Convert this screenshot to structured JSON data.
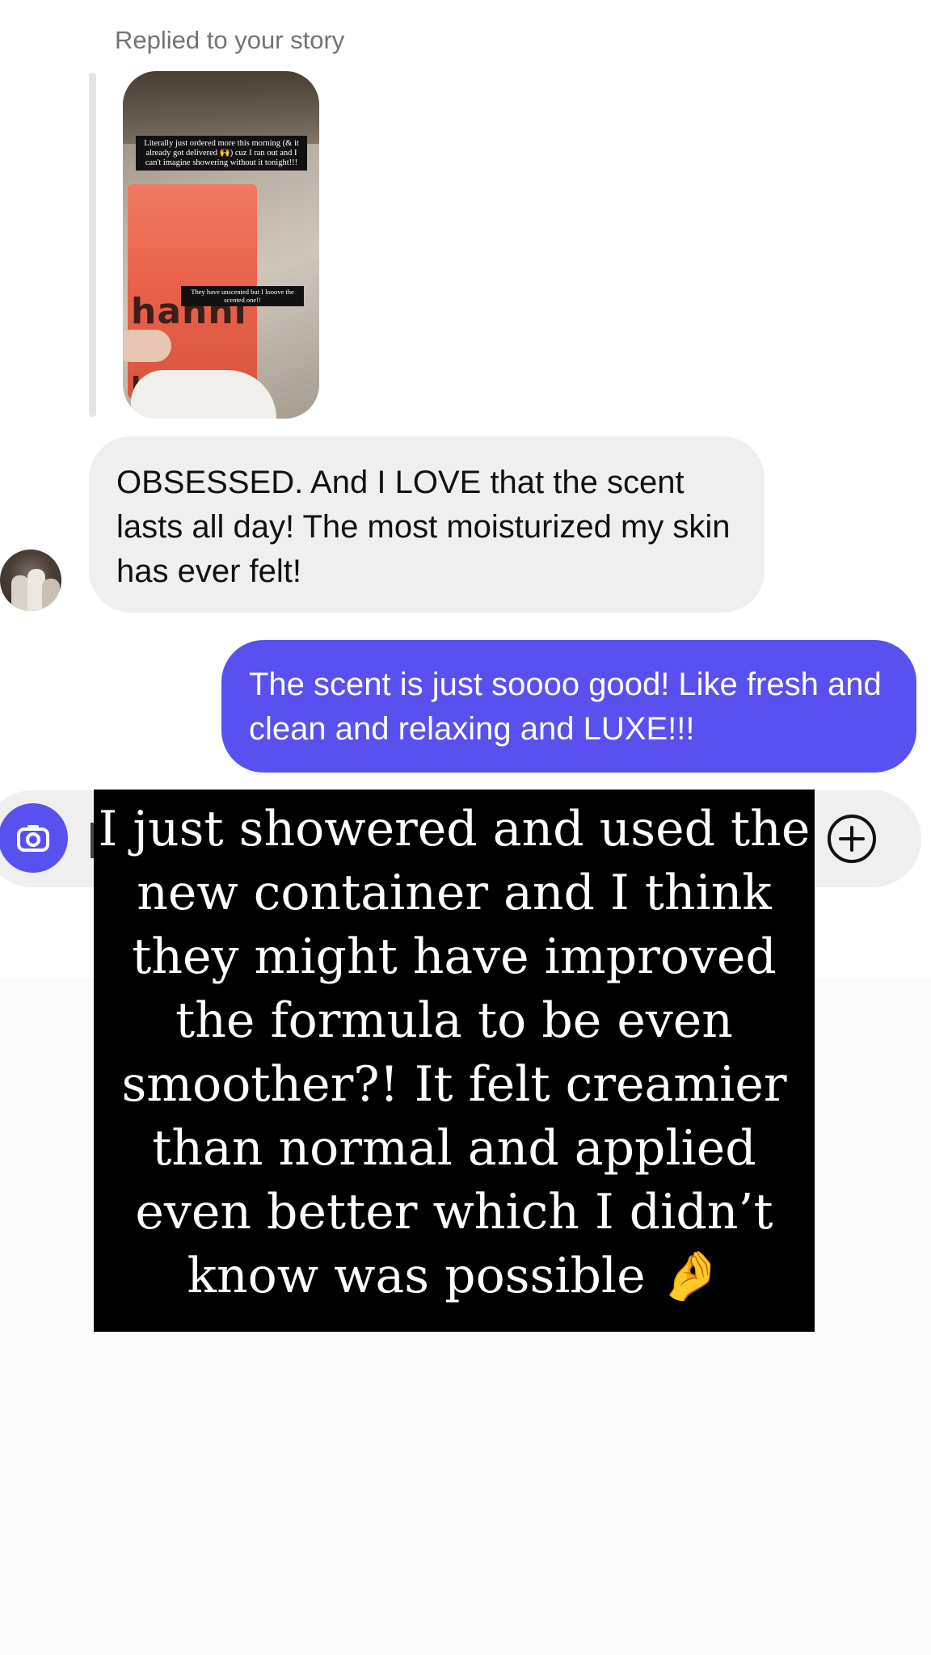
{
  "thread": {
    "reply_label": "Replied to your story",
    "story": {
      "caption_top": "Literally just ordered more this morning (& it already got delivered 🙌) cuz I ran out and I can't imagine showering without it tonight!!!",
      "caption_bottom": "They have unscented but I looove the scented one!!",
      "brand_text": "hanni"
    },
    "incoming_message": "OBSESSED. And I LOVE that the scent lasts all day! The most moisturized my skin has ever felt!",
    "outgoing_message": "The scent is just soooo good! Like fresh and clean and relaxing and LUXE!!!"
  },
  "composer": {
    "camera_icon": "camera-icon",
    "plus_icon": "plus-circle-icon"
  },
  "overlay": {
    "text": "I just showered and used the\nnew container and I think\nthey might have improved\nthe formula to be even\nsmoother?! It felt creamier\nthan normal and applied\neven better which I didn’t\nknow was possible 🤌"
  },
  "colors": {
    "outgoing_bubble": "#5851f0",
    "incoming_bubble": "#efefef",
    "overlay_background": "#000000"
  }
}
